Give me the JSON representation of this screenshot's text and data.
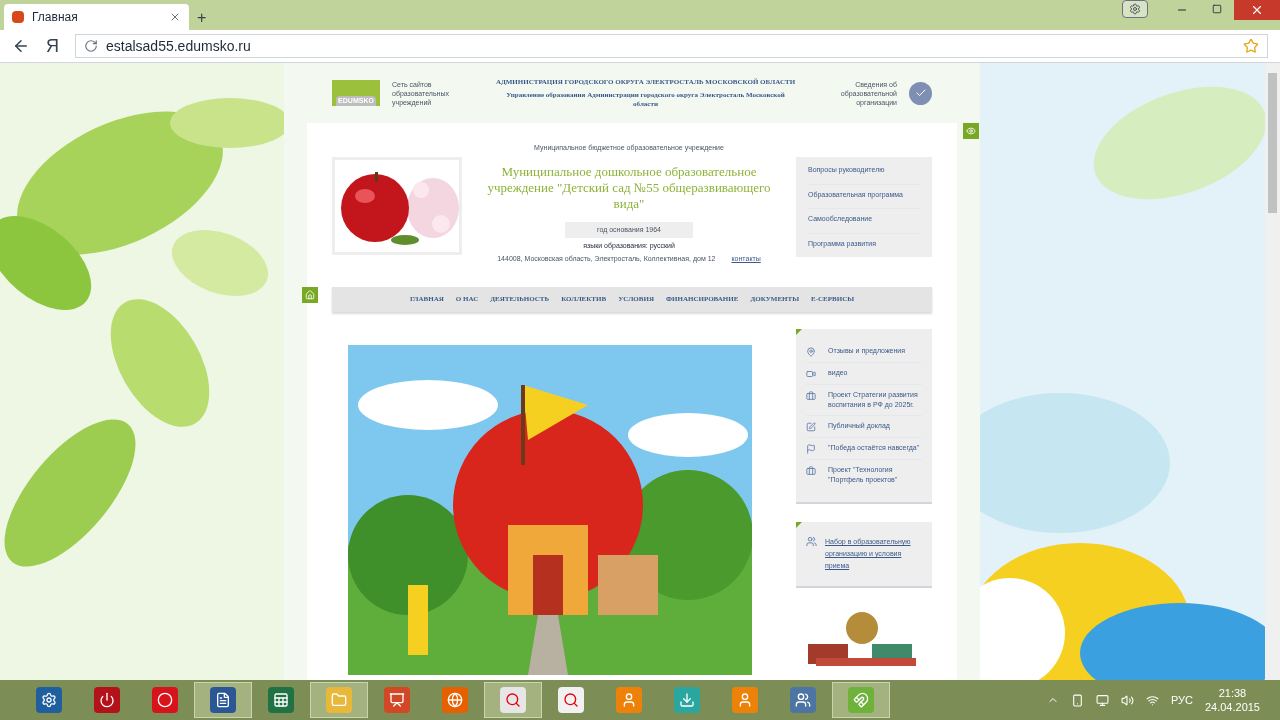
{
  "browser": {
    "tab_title": "Главная",
    "new_tab": "+",
    "address": "estalsad55.edumsko.ru",
    "ya_button": "Я"
  },
  "header": {
    "logo_text": "EDUMSKO",
    "network_text": "Сеть сайтов образовательных учреждений",
    "admin_title": "АДМИНИСТРАЦИЯ ГОРОДСКОГО ОКРУГА ЭЛЕКТРОСТАЛЬ МОСКОВСКОЙ ОБЛАСТИ",
    "admin_subtitle": "Управление образования Администрации городского округа Электросталь Московской области",
    "info_link": "Сведения об образовательной организации"
  },
  "school": {
    "kind": "Муниципальное бюджетное образовательное учреждение",
    "name": "Муниципальное дошкольное образовательное учреждение \"Детский сад №55 общеразвивающего вида\"",
    "founded": "год основания 1964",
    "language": "языки образования: русский",
    "address": "144008, Московская область, Электросталь, Коллективная, дом 12",
    "contacts": "контакты"
  },
  "quick_links": [
    "Вопросы руководителю",
    "Образовательная программа",
    "Самообследование",
    "Программа развития"
  ],
  "nav": [
    "ГЛАВНАЯ",
    "О НАС",
    "ДЕЯТЕЛЬНОСТЬ",
    "КОЛЛЕКТИВ",
    "УСЛОВИЯ",
    "ФИНАНСИРОВАНИЕ",
    "ДОКУМЕНТЫ",
    "Е-СЕРВИСЫ"
  ],
  "side_links": [
    {
      "kind": "pin",
      "label": "Отзывы и предложения"
    },
    {
      "kind": "video",
      "label": "видео"
    },
    {
      "kind": "case",
      "label": "Проект Стратегии развития воспитания в РФ до 2025г."
    },
    {
      "kind": "edit",
      "label": "Публичный доклад"
    },
    {
      "kind": "flag",
      "label": "\"Победа остаётся навсегда\""
    },
    {
      "kind": "case",
      "label": "Проект \"Технология \"Портфель проектов\""
    }
  ],
  "admission": {
    "label": "Набор в образовательную организацию и условия приема"
  },
  "taskbar": {
    "apps": [
      {
        "kind": "settings",
        "selected": false
      },
      {
        "kind": "power",
        "selected": false
      },
      {
        "kind": "opera",
        "selected": false
      },
      {
        "kind": "word",
        "selected": true
      },
      {
        "kind": "excel",
        "selected": false
      },
      {
        "kind": "folder",
        "selected": true
      },
      {
        "kind": "slides",
        "selected": false
      },
      {
        "kind": "firefox",
        "selected": false
      },
      {
        "kind": "yandex",
        "selected": true
      },
      {
        "kind": "yabar",
        "selected": false
      },
      {
        "kind": "ok",
        "selected": false
      },
      {
        "kind": "download",
        "selected": false
      },
      {
        "kind": "ok",
        "selected": false
      },
      {
        "kind": "vk",
        "selected": false
      },
      {
        "kind": "torrent",
        "selected": true
      }
    ],
    "language": "РУС",
    "time": "21:38",
    "date": "24.04.2015"
  }
}
